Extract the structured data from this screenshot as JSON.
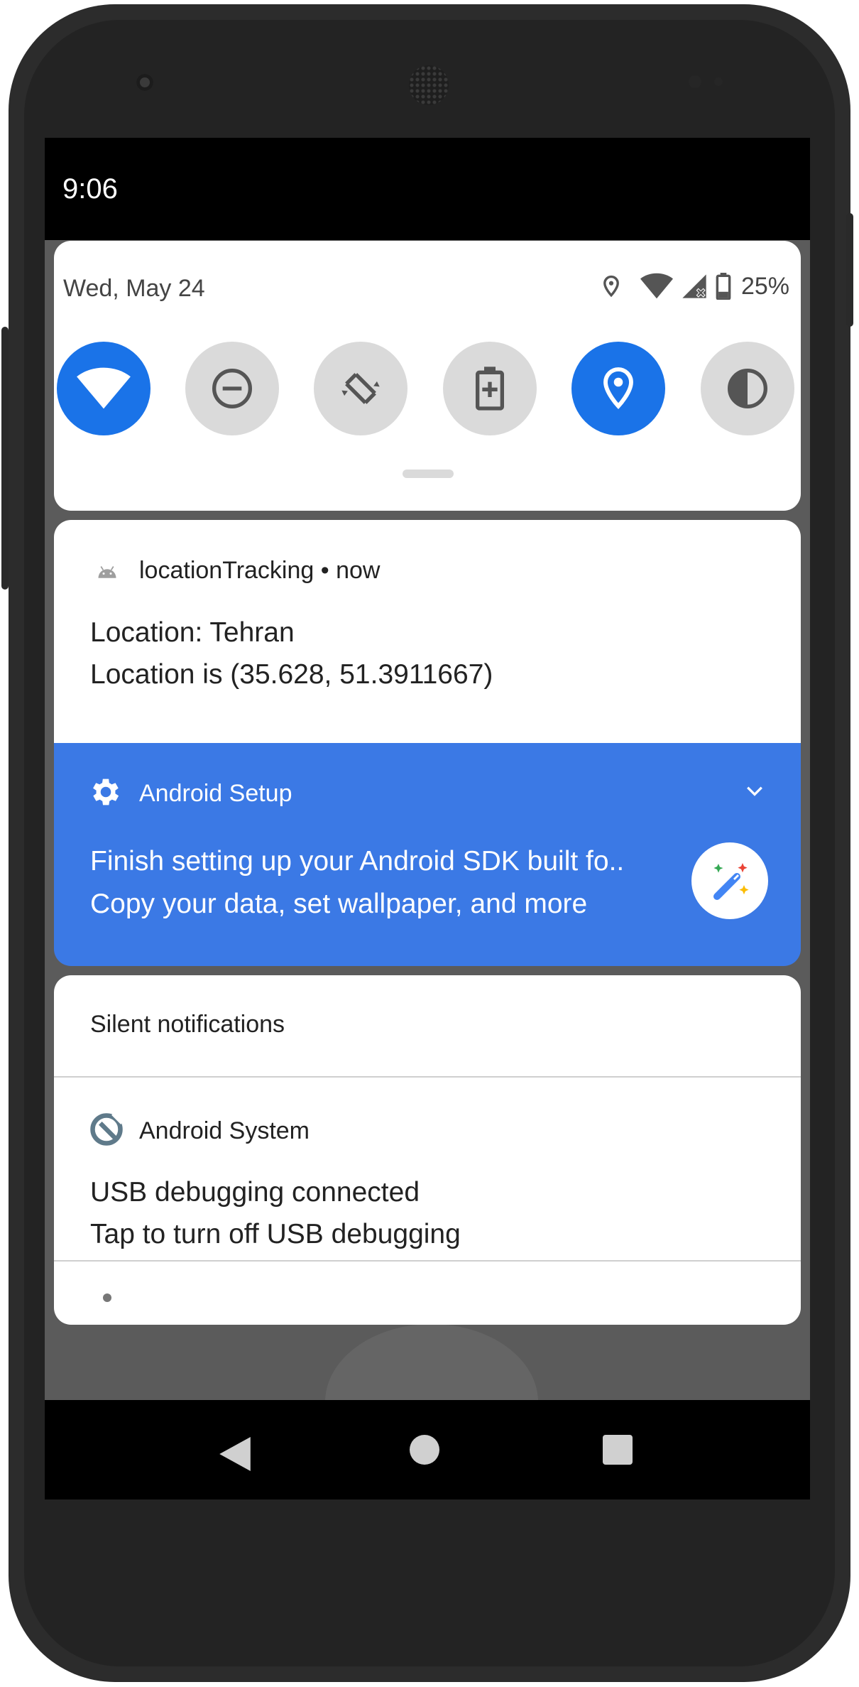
{
  "status_bar": {
    "time": "9:06"
  },
  "quick_settings": {
    "date": "Wed, May 24",
    "battery_percent": "25%",
    "tiles": [
      {
        "name": "wifi",
        "icon": "wifi-icon",
        "active": true
      },
      {
        "name": "do-not-disturb",
        "icon": "do-not-disturb-icon",
        "active": false
      },
      {
        "name": "auto-rotate",
        "icon": "auto-rotate-icon",
        "active": false
      },
      {
        "name": "battery-saver",
        "icon": "battery-saver-icon",
        "active": false
      },
      {
        "name": "location",
        "icon": "location-icon",
        "active": true
      },
      {
        "name": "dark-theme",
        "icon": "dark-theme-icon",
        "active": false
      }
    ]
  },
  "notifications": {
    "location": {
      "app_name": "locationTracking",
      "time": "now",
      "title": "Location: Tehran",
      "text": "Location is (35.628, 51.3911667)"
    },
    "setup": {
      "app_name": "Android Setup",
      "title": "Finish setting up your Android SDK built fo..",
      "text": "Copy your data, set wallpaper, and more"
    },
    "silent_header": "Silent notifications",
    "system": {
      "app_name": "Android System",
      "title": "USB debugging connected",
      "text": "Tap to turn off USB debugging"
    }
  },
  "colors": {
    "accent": "#1a73e8",
    "setup_bg": "#3b79e5",
    "tile_off": "#dadada"
  }
}
